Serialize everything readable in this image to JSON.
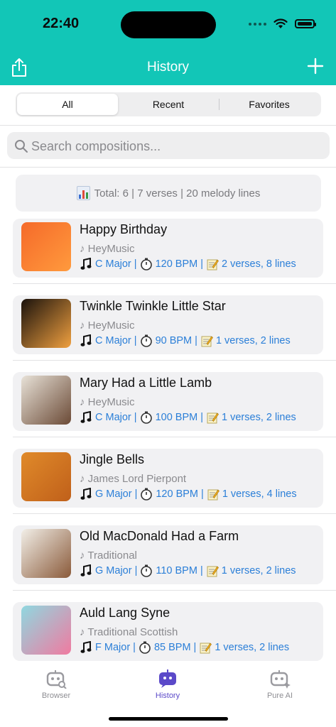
{
  "status": {
    "time": "22:40"
  },
  "nav": {
    "title": "History"
  },
  "segments": [
    {
      "label": "All",
      "active": true
    },
    {
      "label": "Recent",
      "active": false
    },
    {
      "label": "Favorites",
      "active": false
    }
  ],
  "search": {
    "placeholder": "Search compositions..."
  },
  "summary": {
    "text": "Total: 6 | 7 verses | 20 melody lines"
  },
  "compositions": [
    {
      "title": "Happy Birthday",
      "artist": "♪ HeyMusic",
      "key": "C Major |",
      "bpm": "120 BPM |",
      "counts": "2 verses, 8 lines",
      "thumb_colors": [
        "#f56a2a",
        "#ff9a3d"
      ]
    },
    {
      "title": "Twinkle Twinkle Little Star",
      "artist": "♪ HeyMusic",
      "key": "C Major |",
      "bpm": "90 BPM |",
      "counts": "1 verses, 2 lines",
      "thumb_colors": [
        "#1a120c",
        "#f0a040"
      ]
    },
    {
      "title": "Mary Had a Little Lamb",
      "artist": "♪ HeyMusic",
      "key": "C Major |",
      "bpm": "100 BPM |",
      "counts": "1 verses, 2 lines",
      "thumb_colors": [
        "#e8e2d8",
        "#6b4a36"
      ]
    },
    {
      "title": "Jingle Bells",
      "artist": "♪ James Lord Pierpont",
      "key": "G Major |",
      "bpm": "120 BPM |",
      "counts": "1 verses, 4 lines",
      "thumb_colors": [
        "#e08a2a",
        "#c0601a"
      ]
    },
    {
      "title": "Old MacDonald Had a Farm",
      "artist": "♪ Traditional",
      "key": "G Major |",
      "bpm": "110 BPM |",
      "counts": "1 verses, 2 lines",
      "thumb_colors": [
        "#f2efe8",
        "#8a5a3a"
      ]
    },
    {
      "title": "Auld Lang Syne",
      "artist": "♪ Traditional Scottish",
      "key": "F Major |",
      "bpm": "85 BPM |",
      "counts": "1 verses, 2 lines",
      "thumb_colors": [
        "#8fd8e0",
        "#f07aa0"
      ]
    }
  ],
  "tabbar": [
    {
      "label": "Browser",
      "icon": "robot-search-icon",
      "active": false
    },
    {
      "label": "History",
      "icon": "robot-chat-icon",
      "active": true
    },
    {
      "label": "Pure AI",
      "icon": "robot-sparkle-icon",
      "active": false
    }
  ],
  "colors": {
    "header": "#12c6b7",
    "accent": "#5b49c9",
    "meta_blue": "#2b7fd8"
  }
}
